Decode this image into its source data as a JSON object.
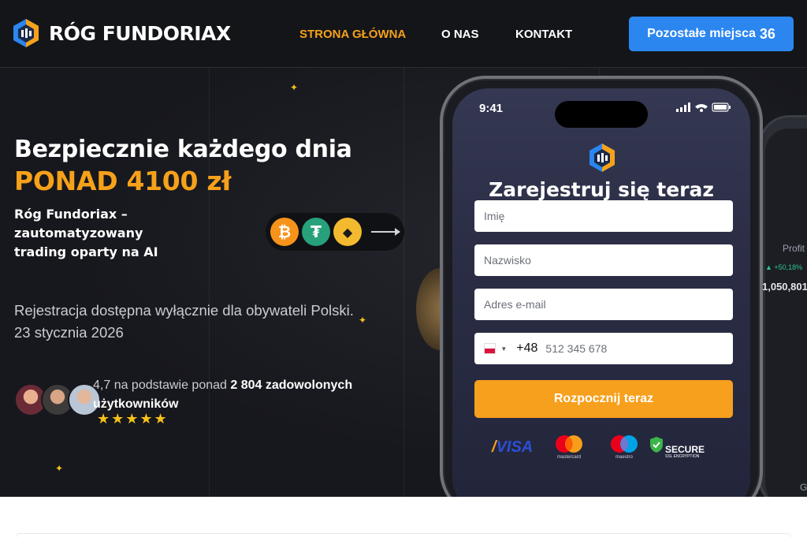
{
  "header": {
    "brand": "RÓG FUNDORIAX",
    "nav": [
      "STRONA GŁÓWNA",
      "O NAS",
      "KONTAKT"
    ],
    "cta_label": "Pozostałe miejsca",
    "cta_count": "36"
  },
  "hero": {
    "title_line1": "Bezpiecznie każdego dnia",
    "title_line2": "PONAD 4100 zł",
    "subtitle": "Róg Fundoriax – zautomatyzowany trading oparty na AI",
    "registration_note": "Rejestracja dostępna wyłącznie dla obywateli Polski.",
    "date": "23 stycznia 2026",
    "coins": [
      "bitcoin-icon",
      "tether-icon",
      "binance-icon"
    ],
    "rating_prefix": "4,7 na podstawie ponad",
    "rating_bold": "2 804 zadowolonych użytkowników",
    "stars": "★★★★★"
  },
  "phone": {
    "time": "9:41",
    "form_title": "Zarejestruj się teraz",
    "fields": {
      "first_name_placeholder": "Imię",
      "last_name_placeholder": "Nazwisko",
      "email_placeholder": "Adres e-mail",
      "phone_code": "+48",
      "phone_placeholder": "512 345 678"
    },
    "submit_label": "Rozpocznij teraz",
    "payments": {
      "visa": "VISA",
      "mastercard": "mastercard",
      "maestro": "maestro",
      "secure_title": "SECURE",
      "secure_sub": "SSL ENCRYPTION"
    }
  },
  "phone2": {
    "profit_label": "Profit",
    "profit_change": "▲ +50,18%",
    "balance": "1,050,801",
    "footer": "Go"
  },
  "colors": {
    "accent": "#f6a11a",
    "cta_blue": "#2b86ef",
    "background": "#17181d"
  }
}
